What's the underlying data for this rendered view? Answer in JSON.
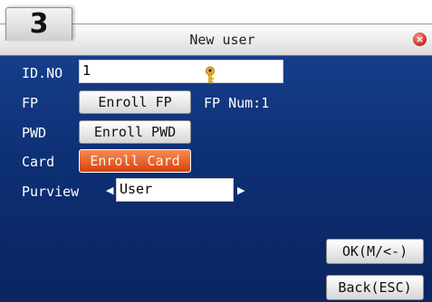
{
  "step": {
    "number": "3"
  },
  "window": {
    "title": "New user",
    "close_icon": "close-icon"
  },
  "form": {
    "id_no": {
      "label": "ID.NO",
      "value": "1"
    },
    "fp": {
      "label": "FP",
      "button": "Enroll FP",
      "info": "FP Num:1"
    },
    "pwd": {
      "label": "PWD",
      "button": "Enroll PWD",
      "icon": "key-icon"
    },
    "card": {
      "label": "Card",
      "button": "Enroll Card"
    },
    "purview": {
      "label": "Purview",
      "value": "User"
    }
  },
  "actions": {
    "ok": "OK(M/<-)",
    "back": "Back(ESC)"
  },
  "colors": {
    "screen_bg": "#0d2f73",
    "selected_button": "#e45a1c",
    "key_icon": "#f0b020"
  }
}
